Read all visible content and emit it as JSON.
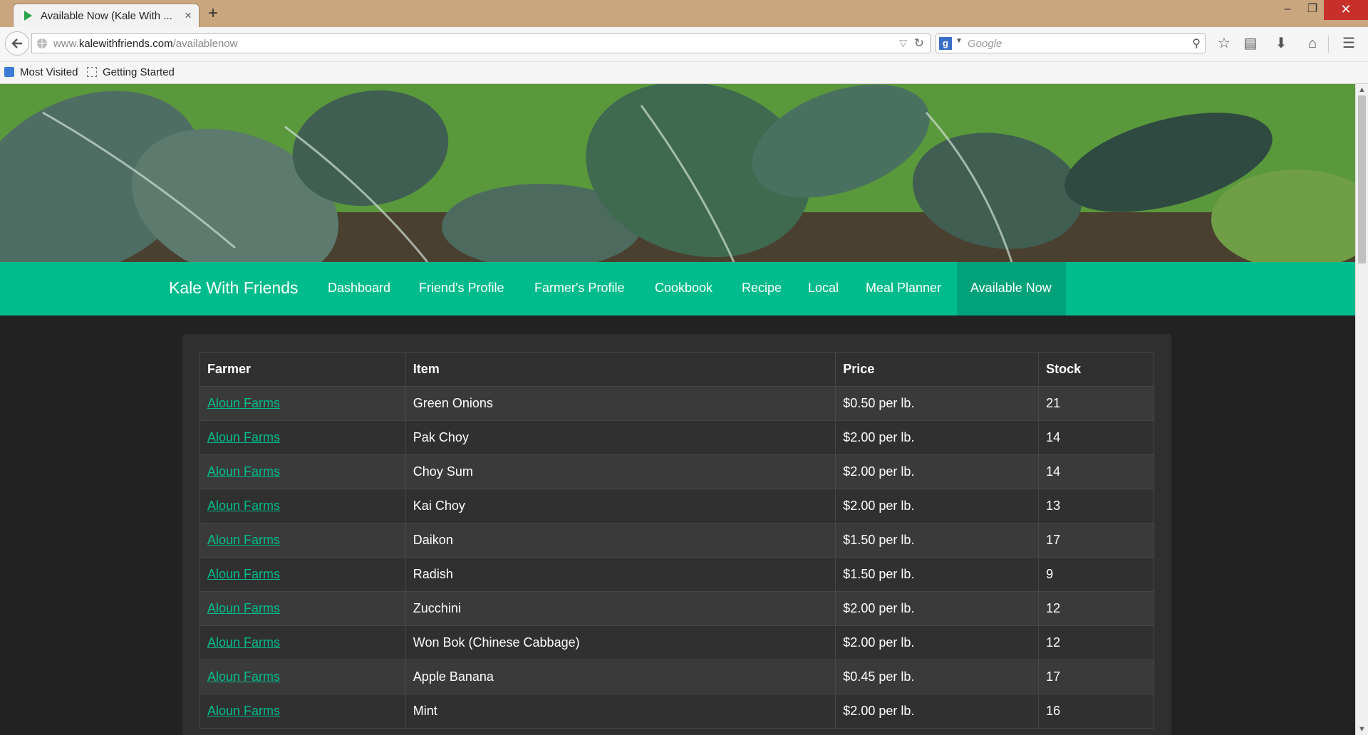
{
  "browser": {
    "tab_title": "Available Now (Kale With ...",
    "url_prefix": "www.",
    "url_domain": "kalewithfriends.com",
    "url_path": "/availablenow",
    "search_placeholder": "Google",
    "bookmarks": [
      "Most Visited",
      "Getting Started"
    ]
  },
  "site": {
    "brand": "Kale With Friends",
    "nav": [
      "Dashboard",
      "Friend's Profile",
      "Farmer's Profile",
      "Cookbook",
      "Recipe",
      "Local",
      "Meal Planner",
      "Available Now"
    ],
    "active_nav": "Available Now",
    "accent_color": "#00bc8c"
  },
  "table": {
    "headers": [
      "Farmer",
      "Item",
      "Price",
      "Stock"
    ],
    "rows": [
      {
        "farmer": "Aloun Farms",
        "item": "Green Onions",
        "price": "$0.50 per lb.",
        "stock": "21"
      },
      {
        "farmer": "Aloun Farms",
        "item": "Pak Choy",
        "price": "$2.00 per lb.",
        "stock": "14"
      },
      {
        "farmer": "Aloun Farms",
        "item": "Choy Sum",
        "price": "$2.00 per lb.",
        "stock": "14"
      },
      {
        "farmer": "Aloun Farms",
        "item": "Kai Choy",
        "price": "$2.00 per lb.",
        "stock": "13"
      },
      {
        "farmer": "Aloun Farms",
        "item": "Daikon",
        "price": "$1.50 per lb.",
        "stock": "17"
      },
      {
        "farmer": "Aloun Farms",
        "item": "Radish",
        "price": "$1.50 per lb.",
        "stock": "9"
      },
      {
        "farmer": "Aloun Farms",
        "item": "Zucchini",
        "price": "$2.00 per lb.",
        "stock": "12"
      },
      {
        "farmer": "Aloun Farms",
        "item": "Won Bok (Chinese Cabbage)",
        "price": "$2.00 per lb.",
        "stock": "12"
      },
      {
        "farmer": "Aloun Farms",
        "item": "Apple Banana",
        "price": "$0.45 per lb.",
        "stock": "17"
      },
      {
        "farmer": "Aloun Farms",
        "item": "Mint",
        "price": "$2.00 per lb.",
        "stock": "16"
      }
    ]
  }
}
